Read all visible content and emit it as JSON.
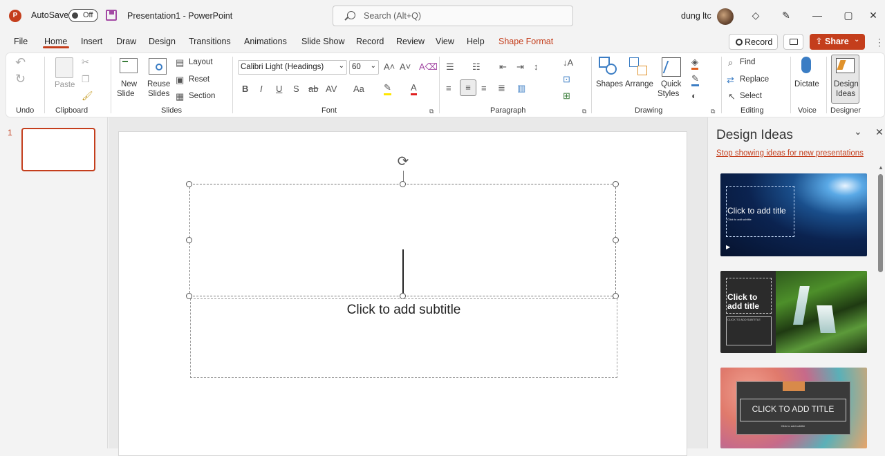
{
  "titlebar": {
    "autosave_label": "AutoSave",
    "autosave_state": "Off",
    "doc_title": "Presentation1  -  PowerPoint",
    "search_placeholder": "Search (Alt+Q)",
    "user_name": "dung ltc"
  },
  "tabs": [
    "File",
    "Home",
    "Insert",
    "Draw",
    "Design",
    "Transitions",
    "Animations",
    "Slide Show",
    "Record",
    "Review",
    "View",
    "Help",
    "Shape Format"
  ],
  "active_tab": "Home",
  "actions": {
    "record": "Record",
    "share": "Share"
  },
  "ribbon": {
    "groups": {
      "undo": "Undo",
      "clipboard": "Clipboard",
      "slides": "Slides",
      "font": "Font",
      "paragraph": "Paragraph",
      "drawing": "Drawing",
      "editing": "Editing",
      "voice": "Voice",
      "designer": "Designer"
    },
    "paste": "Paste",
    "new_slide": [
      "New",
      "Slide"
    ],
    "reuse_slides": [
      "Reuse",
      "Slides"
    ],
    "layout": "Layout",
    "reset": "Reset",
    "section": "Section",
    "font_name": "Calibri Light (Headings)",
    "font_size": "60",
    "shapes": "Shapes",
    "arrange": "Arrange",
    "quick_styles": [
      "Quick",
      "Styles"
    ],
    "find": "Find",
    "replace": "Replace",
    "select": "Select",
    "dictate": "Dictate",
    "design_ideas": [
      "Design",
      "Ideas"
    ]
  },
  "thumbnails": {
    "slide_number": "1"
  },
  "slide": {
    "subtitle_placeholder": "Click to add subtitle"
  },
  "design_pane": {
    "title": "Design Ideas",
    "stop_link": "Stop showing ideas for new presentations",
    "ideas": [
      {
        "title": "Click to add title",
        "subtitle": "Click to add subtitle"
      },
      {
        "title": "Click to add title",
        "subtitle": "CLICK TO ADD SUBTITLE"
      },
      {
        "title": "CLICK TO ADD TITLE",
        "subtitle": "Click to add subtitle"
      }
    ]
  },
  "colors": {
    "accent": "#c43e1c",
    "share_bg": "#c43e1c",
    "designer_purple": "#a349a4"
  }
}
